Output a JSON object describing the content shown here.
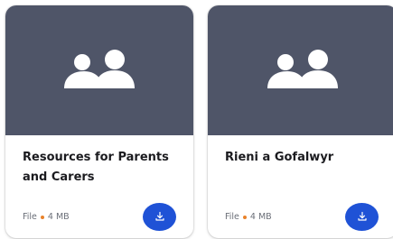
{
  "cards": [
    {
      "icon": "people-icon",
      "title": "Resources for Parents and Carers",
      "file_type": "File",
      "file_size": "4 MB",
      "download_icon": "download-icon"
    },
    {
      "icon": "people-icon",
      "title": "Rieni a Gofalwyr",
      "file_type": "File",
      "file_size": "4 MB",
      "download_icon": "download-icon"
    }
  ],
  "colors": {
    "thumbnail_bg": "#4f5568",
    "accent_blue": "#1f52d6",
    "separator_dot": "#e8822a"
  }
}
